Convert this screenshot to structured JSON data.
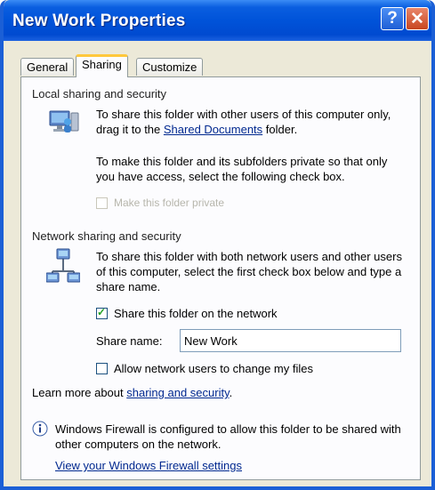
{
  "window": {
    "title": "New Work Properties"
  },
  "titlebar": {
    "help_glyph": "?",
    "close_glyph": "✕"
  },
  "tabs": [
    {
      "label": "General"
    },
    {
      "label": "Sharing"
    },
    {
      "label": "Customize"
    }
  ],
  "local": {
    "heading": "Local sharing and security",
    "text_before": "To share this folder with other users of this computer only, drag it to the ",
    "link": "Shared Documents",
    "text_after": " folder.",
    "private_text": "To make this folder and its subfolders private so that only you have access, select the following check box.",
    "private_checkbox_label": "Make this folder private",
    "private_checked": false,
    "icon": "computer-users-icon"
  },
  "network": {
    "heading": "Network sharing and security",
    "text": "To share this folder with both network users and other users of this computer, select the first check box below and type a share name.",
    "share_checkbox_label": "Share this folder on the network",
    "share_checked": true,
    "share_name_label": "Share name:",
    "share_name_value": "New Work",
    "allow_checkbox_label": "Allow network users to change my files",
    "allow_checked": false,
    "icon": "network-share-icon"
  },
  "learn": {
    "prefix": "Learn more about ",
    "link": "sharing and security",
    "suffix": "."
  },
  "firewall": {
    "icon": "info-icon",
    "text": "Windows Firewall is configured to allow this folder to be shared with other computers on the network.",
    "link": "View your Windows Firewall settings"
  },
  "colors": {
    "titlebar": "#0053d9",
    "face": "#ece9d8",
    "link": "#00288f"
  }
}
